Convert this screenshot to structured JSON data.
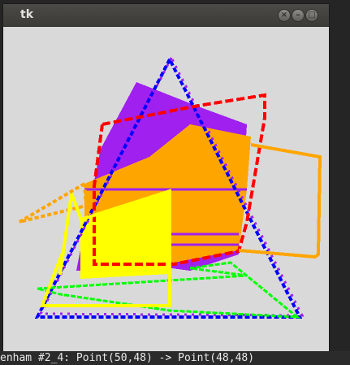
{
  "window": {
    "title": "tk",
    "close_glyph": "×",
    "minimize_glyph": "–",
    "maximize_glyph": "□"
  },
  "canvas": {
    "background": "#d9d9d9",
    "colors": {
      "red": "#ff0000",
      "blue": "#0000ff",
      "purple": "#a020f0",
      "orange": "#ffa500",
      "yellow": "#ffff00",
      "green": "#00ff00"
    }
  },
  "terminal": {
    "text": "enham #2_4: Point(50,48) -> Point(48,48)"
  }
}
